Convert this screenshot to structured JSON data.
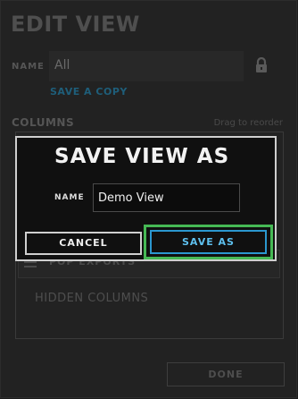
{
  "panel": {
    "title": "EDIT VIEW",
    "name_label": "NAME",
    "name_value": "All",
    "save_copy_label": "SAVE A COPY",
    "columns_label": "COLUMNS",
    "drag_hint": "Drag to reorder",
    "visible_column": "POP EXPORTS",
    "hidden_columns_label": "HIDDEN COLUMNS",
    "done_label": "DONE"
  },
  "modal": {
    "title": "SAVE VIEW AS",
    "name_label": "NAME",
    "name_value": "Demo View",
    "cancel_label": "CANCEL",
    "save_as_label": "SAVE AS"
  },
  "colors": {
    "accent": "#2b97cf",
    "highlight": "#46b955",
    "link": "#1e5e7a"
  },
  "icons": {
    "lock": "lock-icon",
    "drag_handle": "drag-handle-icon"
  }
}
